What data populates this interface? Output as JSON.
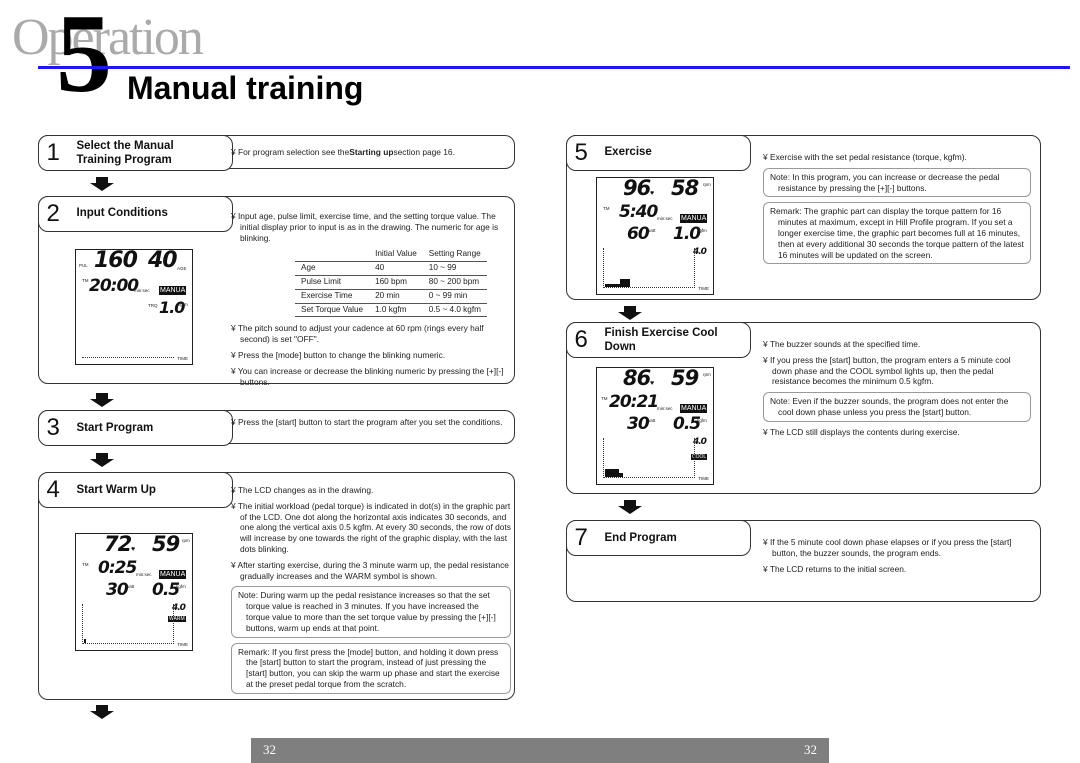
{
  "header": {
    "section_word": "Operation",
    "section_number": "5",
    "title": "Manual training",
    "accent_color": "#1a1af0"
  },
  "steps": [
    {
      "number": "1",
      "title": "Select the Manual Training Program",
      "items": [
        "For program selection see the Starting up section page 16."
      ]
    },
    {
      "number": "2",
      "title": "Input Conditions",
      "items": [
        "Input age, pulse limit, exercise time, and the setting torque value. The initial display prior to input is as in the drawing. The numeric for age is blinking.",
        "The pitch sound to adjust your cadence at 60 rpm (rings every half second) is set \"OFF\".",
        "Press the [mode] button to change the blinking numeric.",
        "You can increase or decrease the blinking numeric by pressing the [+][-] buttons."
      ],
      "table": {
        "headers": [
          "",
          "Initial Value",
          "Setting Range"
        ],
        "rows": [
          [
            "Age",
            "40",
            "10 ~  99"
          ],
          [
            "Pulse Limit",
            "160 bpm",
            "80 ~ 200 bpm"
          ],
          [
            "Exercise Time",
            "20 min",
            "0 ~  99 min"
          ],
          [
            "Set Torque Value",
            "1.0 kgfm",
            "0.5 ~  4.0 kgfm"
          ]
        ]
      },
      "lcd": {
        "top_left": "160",
        "top_left_label": "PUL",
        "top_right": "40",
        "top_right_unit": "AGE",
        "time_label": "TM",
        "time": "20:00",
        "time_unit": "min:sec",
        "mode": "MANUA",
        "torque_label": "TRQ",
        "torque": "1.0",
        "torque_unit": "kgfm",
        "axis_label": "TIME"
      }
    },
    {
      "number": "3",
      "title": "Start Program",
      "items": [
        "Press the [start] button to start the program after you set the conditions."
      ]
    },
    {
      "number": "4",
      "title": "Start Warm Up",
      "items": [
        "The LCD changes as in the drawing.",
        "The initial workload (pedal torque) is indicated in dot(s) in the graphic part of the LCD. One dot along the horizontal axis indicates 30 seconds, and one along the vertical axis 0.5 kgfm. At every 30 seconds, the row of dots will increase by one towards the right of the graphic display, with the last dots blinking.",
        "After starting exercise, during the 3 minute warm up, the pedal resistance gradually increases and the WARM symbol is shown."
      ],
      "note": "Note: During warm up the pedal resistance increases so that the set torque value is reached in 3 minutes. If you have increased the torque value to more than the set torque value by pressing the [+][-] buttons, warm up ends at that point.",
      "remark": "Remark: If you first press the [mode] button, and holding it down press the [start] button to start the program, instead of just pressing the [start] button, you can skip the warm up phase and start the exercise at the preset pedal torque from the scratch.",
      "lcd": {
        "pulse": "72",
        "rpm": "59",
        "rpm_unit": "rpm",
        "time_label": "TM",
        "time": "0:25",
        "time_unit": "min:sec",
        "mode": "MANUA",
        "watt": "30",
        "watt_unit": "watt",
        "torque": "0.5",
        "torque_unit": "kgfm",
        "max": "4.0",
        "status": "WARM",
        "axis_label": "TIME"
      }
    },
    {
      "number": "5",
      "title": "Exercise",
      "items": [
        "Exercise with the set pedal resistance (torque, kgfm)."
      ],
      "note": "Note: In this program, you can increase or decrease the pedal resistance by pressing the [+][-] buttons.",
      "remark": "Remark: The graphic part can display the torque pattern for 16 minutes at maximum, except in Hill Profile program. If you set a longer exercise time, the graphic part becomes full at 16 minutes, then at every additional 30 seconds the torque pattern of the latest 16 minutes will be updated on the screen.",
      "lcd": {
        "pulse": "96",
        "rpm": "58",
        "rpm_unit": "rpm",
        "time_label": "TM",
        "time": "5:40",
        "time_unit": "min:sec",
        "mode": "MANUA",
        "watt": "60",
        "watt_unit": "watt",
        "torque": "1.0",
        "torque_unit": "kgfm",
        "max": "4.0",
        "axis_label": "TIME"
      }
    },
    {
      "number": "6",
      "title": "Finish Exercise Cool Down",
      "items": [
        "The buzzer sounds at the specified time.",
        "If you press the [start] button, the program enters a 5 minute cool down phase and the COOL symbol lights up, then the pedal resistance becomes the minimum 0.5 kgfm."
      ],
      "note": "Note: Even if the buzzer sounds, the program does not enter the cool down phase unless you press the [start] button.",
      "items_after": [
        "The LCD still displays the contents during exercise."
      ],
      "lcd": {
        "pulse": "86",
        "rpm": "59",
        "rpm_unit": "rpm",
        "time_label": "TM",
        "time": "20:21",
        "time_unit": "min:sec",
        "mode": "MANUA",
        "watt": "30",
        "watt_unit": "watt",
        "torque": "0.5",
        "torque_unit": "kgfm",
        "max": "4.0",
        "status": "COOL",
        "axis_label": "TIME"
      }
    },
    {
      "number": "7",
      "title": "End Program",
      "items": [
        "If the 5 minute cool down phase elapses or if you press the [start] button, the buzzer sounds, the program ends.",
        "The LCD returns to the initial screen."
      ]
    }
  ],
  "footer": {
    "page_left": "32",
    "page_right": "32"
  }
}
